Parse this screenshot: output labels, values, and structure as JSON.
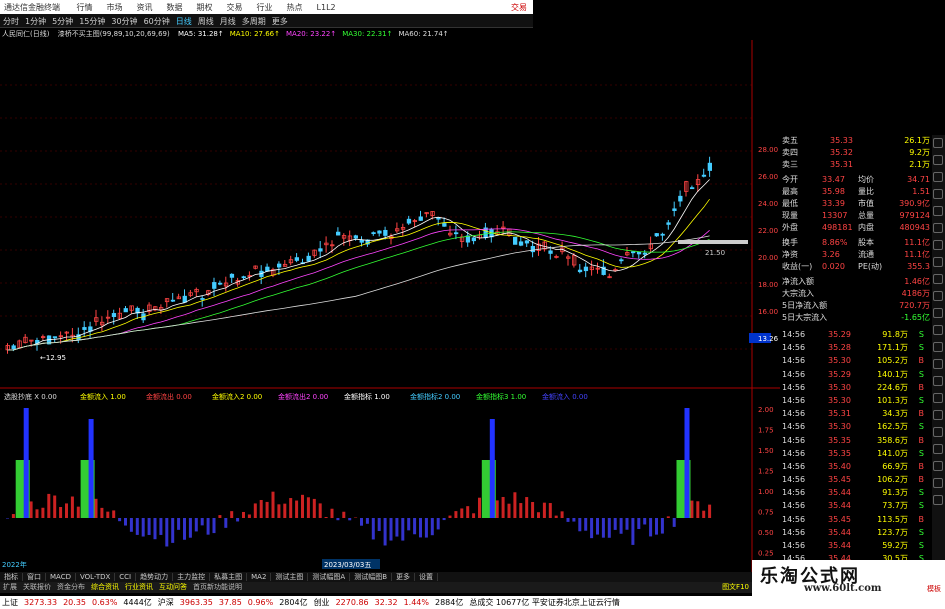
{
  "window": {
    "title": "通达信金融终端",
    "menu": [
      "行情",
      "市场",
      "资讯",
      "数据",
      "期权",
      "交易",
      "行业",
      "热点",
      "L1L2"
    ],
    "right_label": "交易"
  },
  "periods": [
    "分时",
    "1分钟",
    "5分钟",
    "15分钟",
    "30分钟",
    "60分钟",
    "日线",
    "周线",
    "月线",
    "多周期",
    "更多"
  ],
  "active_period": "日线",
  "indicator": {
    "stock": "人民同仁(日线)",
    "formula": "漆桥不买主图(99,89,10,20,69,69)",
    "ma": [
      {
        "label": "MA5: 31.28↑",
        "color": "#ffffff"
      },
      {
        "label": "MA10: 27.66↑",
        "color": "#ffff00"
      },
      {
        "label": "MA20: 23.22↑",
        "color": "#ff44ff"
      },
      {
        "label": "MA30: 22.31↑",
        "color": "#33ff33"
      },
      {
        "label": "MA60: 21.74↑",
        "color": "#dddddd"
      }
    ]
  },
  "price_axis": [
    "28.00",
    "26.00",
    "24.00",
    "22.00",
    "20.00",
    "18.00",
    "16.00",
    "13.26"
  ],
  "price_labels": {
    "low": "12.95",
    "mark": "21.50"
  },
  "sub": {
    "title": "选股抄底 X 0.00",
    "labels": [
      "金额流入 1.00",
      "金额流出 0.00",
      "金额流入2 0.00",
      "金额流出2 0.00",
      "金额指标 1.00",
      "金额指标2 0.00",
      "金额指标3 1.00",
      "金额流入 0.00"
    ],
    "axis": [
      "2.00",
      "1.75",
      "1.50",
      "1.25",
      "1.00",
      "0.75",
      "0.50",
      "0.25",
      "0.00"
    ],
    "date_left": "2022年",
    "date_mid": "2023/03/03五"
  },
  "quote": {
    "book": [
      {
        "label": "卖五",
        "price": "35.33",
        "vol": "26.1万"
      },
      {
        "label": "卖四",
        "price": "35.32",
        "vol": "9.2万"
      },
      {
        "label": "卖三",
        "price": "35.31",
        "vol": "2.1万"
      }
    ],
    "stats": [
      {
        "l1": "今开",
        "v1": "33.47",
        "l2": "均价",
        "v2": "34.71"
      },
      {
        "l1": "最高",
        "v1": "35.98",
        "l2": "量比",
        "v2": "1.51"
      },
      {
        "l1": "最低",
        "v1": "33.39",
        "l2": "市值",
        "v2": "390.9亿"
      },
      {
        "l1": "现量",
        "v1": "13307",
        "l2": "总量",
        "v2": "979124"
      },
      {
        "l1": "外盘",
        "v1": "498181",
        "l2": "内盘",
        "v2": "480943"
      }
    ],
    "stats2": [
      {
        "l1": "换手",
        "v1": "8.86%",
        "l2": "股本",
        "v2": "11.1亿"
      },
      {
        "l1": "净资",
        "v1": "3.26",
        "l2": "流通",
        "v2": "11.1亿"
      },
      {
        "l1": "收益(一)",
        "v1": "0.020",
        "l2": "PE(动)",
        "v2": "355.3"
      }
    ],
    "flows": [
      {
        "label": "净流入额",
        "value": "1.46亿"
      },
      {
        "label": "大宗流入",
        "value": "4186万"
      },
      {
        "label": "5日净流入额",
        "value": "720.7万"
      },
      {
        "label": "5日大宗流入",
        "value": "-1.65亿"
      }
    ],
    "trades": [
      {
        "t": "14:56",
        "p": "35.29",
        "v": "91.8万",
        "s": "S"
      },
      {
        "t": "14:56",
        "p": "35.28",
        "v": "171.1万",
        "s": "S"
      },
      {
        "t": "14:56",
        "p": "35.30",
        "v": "105.2万",
        "s": "B"
      },
      {
        "t": "14:56",
        "p": "35.29",
        "v": "140.1万",
        "s": "S"
      },
      {
        "t": "14:56",
        "p": "35.30",
        "v": "224.6万",
        "s": "B"
      },
      {
        "t": "14:56",
        "p": "35.30",
        "v": "101.3万",
        "s": "S"
      },
      {
        "t": "14:56",
        "p": "35.31",
        "v": "34.3万",
        "s": "B"
      },
      {
        "t": "14:56",
        "p": "35.30",
        "v": "162.5万",
        "s": "S"
      },
      {
        "t": "14:56",
        "p": "35.35",
        "v": "358.6万",
        "s": "B"
      },
      {
        "t": "14:56",
        "p": "35.35",
        "v": "141.0万",
        "s": "S"
      },
      {
        "t": "14:56",
        "p": "35.40",
        "v": "66.9万",
        "s": "B"
      },
      {
        "t": "14:56",
        "p": "35.45",
        "v": "106.2万",
        "s": "B"
      },
      {
        "t": "14:56",
        "p": "35.44",
        "v": "91.3万",
        "s": "S"
      },
      {
        "t": "14:56",
        "p": "35.44",
        "v": "73.7万",
        "s": "S"
      },
      {
        "t": "14:56",
        "p": "35.45",
        "v": "113.5万",
        "s": "B"
      },
      {
        "t": "14:56",
        "p": "35.44",
        "v": "123.7万",
        "s": "S"
      },
      {
        "t": "14:56",
        "p": "35.44",
        "v": "59.2万",
        "s": "S"
      },
      {
        "t": "14:56",
        "p": "35.44",
        "v": "30.5万",
        "s": "S"
      }
    ]
  },
  "tabs": [
    "指标",
    "窗口",
    "MACD",
    "VOL-TDX",
    "CCI",
    "趋势动力",
    "主力监控",
    "私募主图",
    "MA2",
    "测试主图",
    "测试幅图A",
    "测试幅图B",
    "更多",
    "设置"
  ],
  "tabs2": [
    "扩展",
    "关联报价",
    "资金分布",
    "综合资讯",
    "行业资讯",
    "互动问答",
    "首页新功能说明"
  ],
  "tabs2_right": "图文F10",
  "status": [
    {
      "label": "上证",
      "value": "3273.33",
      "c1": "20.35",
      "c2": "0.63%",
      "amt": "4444亿"
    },
    {
      "label": "沪深",
      "value": "3963.35",
      "c1": "37.85",
      "c2": "0.96%",
      "amt": "2804亿"
    },
    {
      "label": "创业",
      "value": "2270.86",
      "c1": "32.32",
      "c2": "1.44%",
      "amt": "2884亿"
    }
  ],
  "status_tail": "总成交 10677亿 平安证券北京上证云行情",
  "watermark": {
    "title": "乐淘公式网",
    "url": "www.60lt.com",
    "corner": "模板"
  },
  "colors": {
    "up": "#ff4444",
    "down": "#33ff33",
    "cyan": "#44ccff",
    "yellow": "#ffff00"
  }
}
